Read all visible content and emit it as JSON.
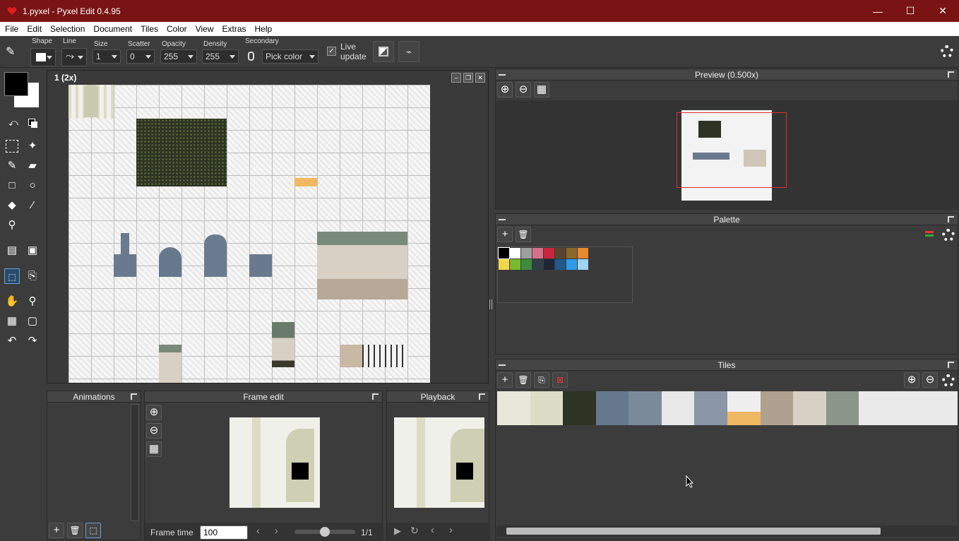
{
  "window": {
    "title": "1.pyxel - Pyxel Edit 0.4.95",
    "minimize": "—",
    "maximize": "☐",
    "close": "✕"
  },
  "menu": [
    "File",
    "Edit",
    "Selection",
    "Document",
    "Tiles",
    "Color",
    "View",
    "Extras",
    "Help"
  ],
  "toolbar": {
    "shape_label": "Shape",
    "line_label": "Line",
    "size_label": "Size",
    "size_value": "1",
    "scatter_label": "Scatter",
    "scatter_value": "0",
    "opacity_label": "Opacity",
    "opacity_value": "255",
    "density_label": "Density",
    "density_value": "255",
    "secondary_label": "Secondary",
    "secondary_value": "Pick color",
    "live_update_line1": "Live",
    "live_update_line2": "update",
    "live_update_checked": true
  },
  "document": {
    "title": "1  (2x)"
  },
  "panels": {
    "preview": "Preview (0.500x)",
    "palette": "Palette",
    "tiles": "Tiles",
    "animations": "Animations",
    "frame_edit": "Frame edit",
    "playback": "Playback"
  },
  "palette_colors": [
    "#000000",
    "#ffffff",
    "#9e9e9e",
    "#d6718b",
    "#c9263d",
    "#5a4430",
    "#8a6a2a",
    "#ea8a2e",
    "#f3d74b",
    "#7ab82e",
    "#3c8c3a",
    "#2e3f46",
    "#1f2636",
    "#1f5a8a",
    "#2f9be8",
    "#9fd3f3"
  ],
  "frame": {
    "time_label": "Frame time",
    "time_value": "100",
    "counter": "1/1"
  }
}
